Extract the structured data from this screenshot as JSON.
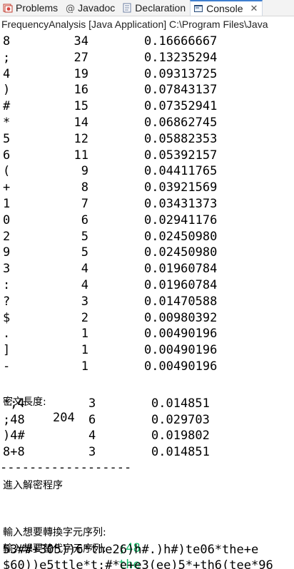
{
  "tabs": [
    {
      "label": "Problems",
      "icon": "problems-icon",
      "active": false
    },
    {
      "label": "Javadoc",
      "icon": "at-icon",
      "active": false
    },
    {
      "label": "Declaration",
      "icon": "declaration-icon",
      "active": false
    },
    {
      "label": "Console",
      "icon": "console-icon",
      "active": true
    }
  ],
  "console_title": "FrequencyAnalysis [Java Application] C:\\Program Files\\Java",
  "frequency_table": [
    {
      "char": "8",
      "count": "34",
      "freq": "0.16666667"
    },
    {
      "char": ";",
      "count": "27",
      "freq": "0.13235294"
    },
    {
      "char": "4",
      "count": "19",
      "freq": "0.09313725"
    },
    {
      "char": ")",
      "count": "16",
      "freq": "0.07843137"
    },
    {
      "char": "#",
      "count": "15",
      "freq": "0.07352941"
    },
    {
      "char": "*",
      "count": "14",
      "freq": "0.06862745"
    },
    {
      "char": "5",
      "count": "12",
      "freq": "0.05882353"
    },
    {
      "char": "6",
      "count": "11",
      "freq": "0.05392157"
    },
    {
      "char": "(",
      "count": "9",
      "freq": "0.04411765"
    },
    {
      "char": "+",
      "count": "8",
      "freq": "0.03921569"
    },
    {
      "char": "1",
      "count": "7",
      "freq": "0.03431373"
    },
    {
      "char": "0",
      "count": "6",
      "freq": "0.02941176"
    },
    {
      "char": "2",
      "count": "5",
      "freq": "0.02450980"
    },
    {
      "char": "9",
      "count": "5",
      "freq": "0.02450980"
    },
    {
      "char": "3",
      "count": "4",
      "freq": "0.01960784"
    },
    {
      "char": ":",
      "count": "4",
      "freq": "0.01960784"
    },
    {
      "char": "?",
      "count": "3",
      "freq": "0.01470588"
    },
    {
      "char": "$",
      "count": "2",
      "freq": "0.00980392"
    },
    {
      "char": ".",
      "count": "1",
      "freq": "0.00490196"
    },
    {
      "char": "]",
      "count": "1",
      "freq": "0.00490196"
    },
    {
      "char": "-",
      "count": "1",
      "freq": "0.00490196"
    }
  ],
  "cipher_length_label": "密文長度:",
  "cipher_length_value": "204",
  "trigram_table": [
    {
      "seq": "*;4",
      "count": "3",
      "freq": "0.014851"
    },
    {
      "seq": ";48",
      "count": "6",
      "freq": "0.029703"
    },
    {
      "seq": ")4#",
      "count": "4",
      "freq": "0.019802"
    },
    {
      "seq": "8+8",
      "count": "3",
      "freq": "0.014851"
    }
  ],
  "separator": "------------------",
  "enter_decrypt": "進入解密程序",
  "prompt_replace_label": "輸入想要轉換字元序列:",
  "prompt_replace_value": ";48",
  "prompt_substitute_label": "輸入想要替代字元序列:",
  "prompt_substitute_value": "the",
  "output_line_1": "53##+305))6*the26)h#.)h#)te06*the+e",
  "output_line_2": "$60))e5ttle*t;#*e+e3(ee)5*+th6(tee*96"
}
